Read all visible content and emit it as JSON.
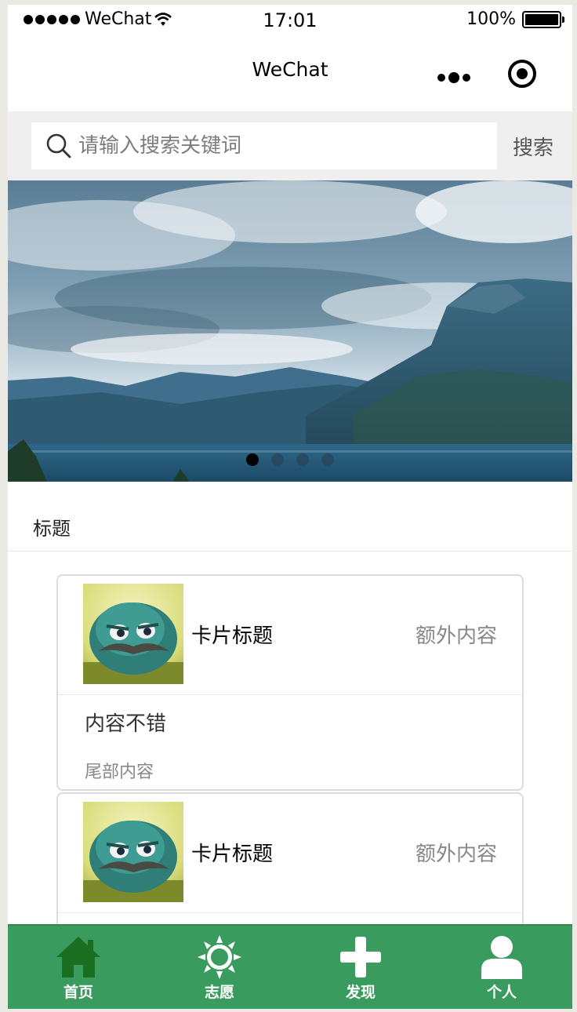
{
  "status_bar": {
    "carrier": "WeChat",
    "time": "17:01",
    "battery": "100%"
  },
  "nav": {
    "title": "WeChat"
  },
  "search": {
    "placeholder": "请输入搜索关键词",
    "button_label": "搜索"
  },
  "banner": {
    "slide_count": 4,
    "active_index": 0
  },
  "section": {
    "title": "标题"
  },
  "cards": [
    {
      "title": "卡片标题",
      "extra": "额外内容",
      "body": "内容不错",
      "footer": "尾部内容"
    },
    {
      "title": "卡片标题",
      "extra": "额外内容"
    }
  ],
  "tab_bar": {
    "background": "#3a9b5e",
    "items": [
      {
        "label": "首页",
        "icon": "home-icon",
        "active": true
      },
      {
        "label": "志愿",
        "icon": "sun-icon",
        "active": false
      },
      {
        "label": "发现",
        "icon": "plus-icon",
        "active": false
      },
      {
        "label": "个人",
        "icon": "person-icon",
        "active": false
      }
    ]
  }
}
